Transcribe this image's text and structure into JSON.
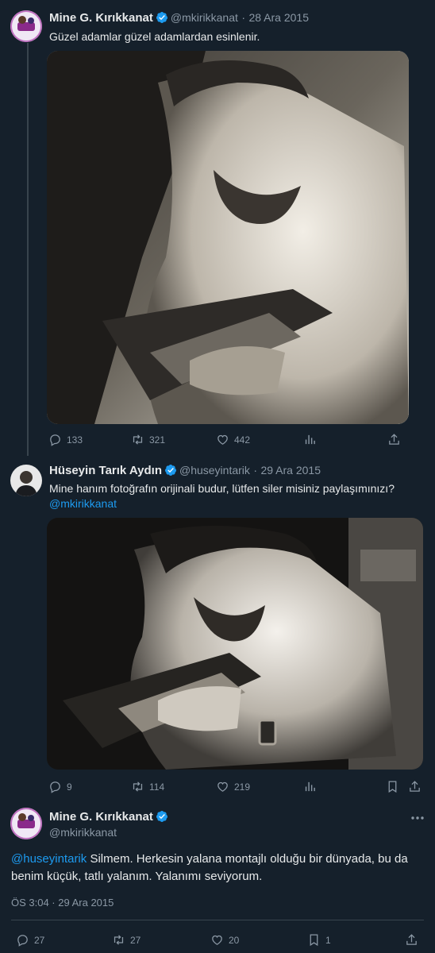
{
  "tweet1": {
    "name": "Mine G. Kırıkkanat",
    "handle": "@mkirikkanat",
    "date_sep": "·",
    "date": "28 Ara 2015",
    "text": "Güzel adamlar güzel adamlardan esinlenir.",
    "stats": {
      "replies": "133",
      "retweets": "321",
      "likes": "442"
    }
  },
  "tweet2": {
    "name": "Hüseyin Tarık Aydın",
    "handle": "@huseyintarik",
    "date_sep": "·",
    "date": "29 Ara 2015",
    "text": "Mine hanım fotoğrafın orijinali budur, lütfen siler misiniz paylaşımınızı?",
    "mention": "@mkirikkanat",
    "stats": {
      "replies": "9",
      "retweets": "114",
      "likes": "219"
    }
  },
  "tweet3": {
    "name": "Mine G. Kırıkkanat",
    "handle": "@mkirikkanat",
    "mention": "@huseyintarik",
    "text": " Silmem. Herkesin yalana montajlı olduğu bir dünyada, bu da benim küçük, tatlı yalanım. Yalanımı seviyorum.",
    "timestamp": "ÖS 3:04 · 29 Ara 2015",
    "stats": {
      "replies": "27",
      "retweets": "27",
      "likes": "20",
      "bookmarks": "1"
    }
  },
  "colors": {
    "background": "#15202b",
    "accent": "#1d9bf0",
    "muted": "#8b98a5"
  },
  "icons": [
    "verified-badge-icon",
    "reply-icon",
    "retweet-icon",
    "like-icon",
    "views-icon",
    "bookmark-icon",
    "share-icon",
    "more-icon"
  ]
}
